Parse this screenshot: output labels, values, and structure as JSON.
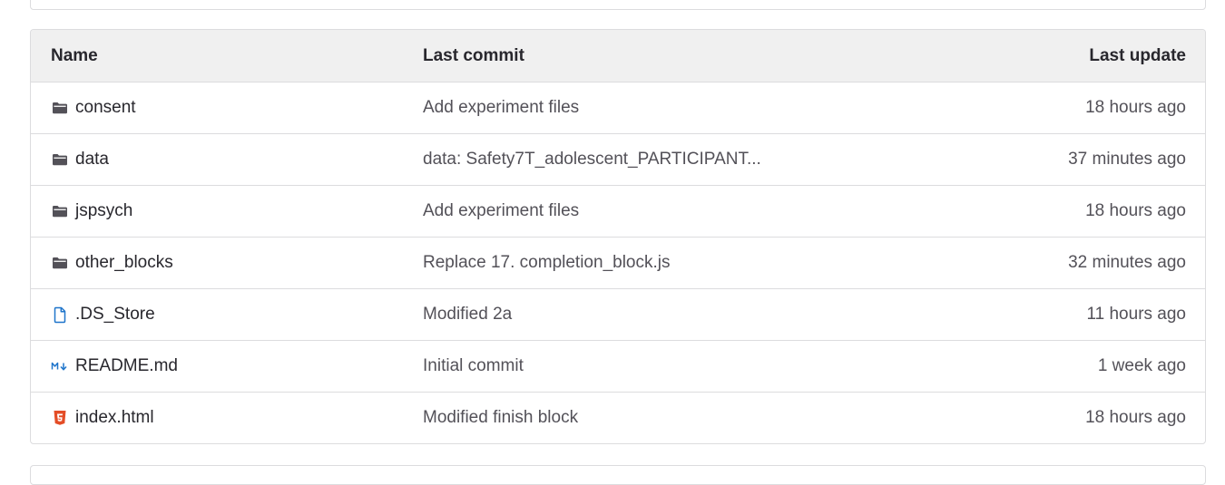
{
  "table": {
    "headers": {
      "name": "Name",
      "last_commit": "Last commit",
      "last_update": "Last update"
    },
    "rows": [
      {
        "name": "consent",
        "icon": "folder-icon",
        "commit": "Add experiment files",
        "updated": "18 hours ago"
      },
      {
        "name": "data",
        "icon": "folder-icon",
        "commit": "data: Safety7T_adolescent_PARTICIPANT...",
        "updated": "37 minutes ago"
      },
      {
        "name": "jspsych",
        "icon": "folder-icon",
        "commit": "Add experiment files",
        "updated": "18 hours ago"
      },
      {
        "name": "other_blocks",
        "icon": "folder-icon",
        "commit": "Replace 17. completion_block.js",
        "updated": "32 minutes ago"
      },
      {
        "name": ".DS_Store",
        "icon": "file-icon",
        "commit": "Modified 2a",
        "updated": "11 hours ago"
      },
      {
        "name": "README.md",
        "icon": "markdown-icon",
        "commit": "Initial commit",
        "updated": "1 week ago"
      },
      {
        "name": "index.html",
        "icon": "html5-icon",
        "commit": "Modified finish block",
        "updated": "18 hours ago"
      }
    ]
  },
  "colors": {
    "folder": "#535158",
    "file": "#1f75cb",
    "markdown": "#1f75cb",
    "html5": "#e44d26"
  }
}
